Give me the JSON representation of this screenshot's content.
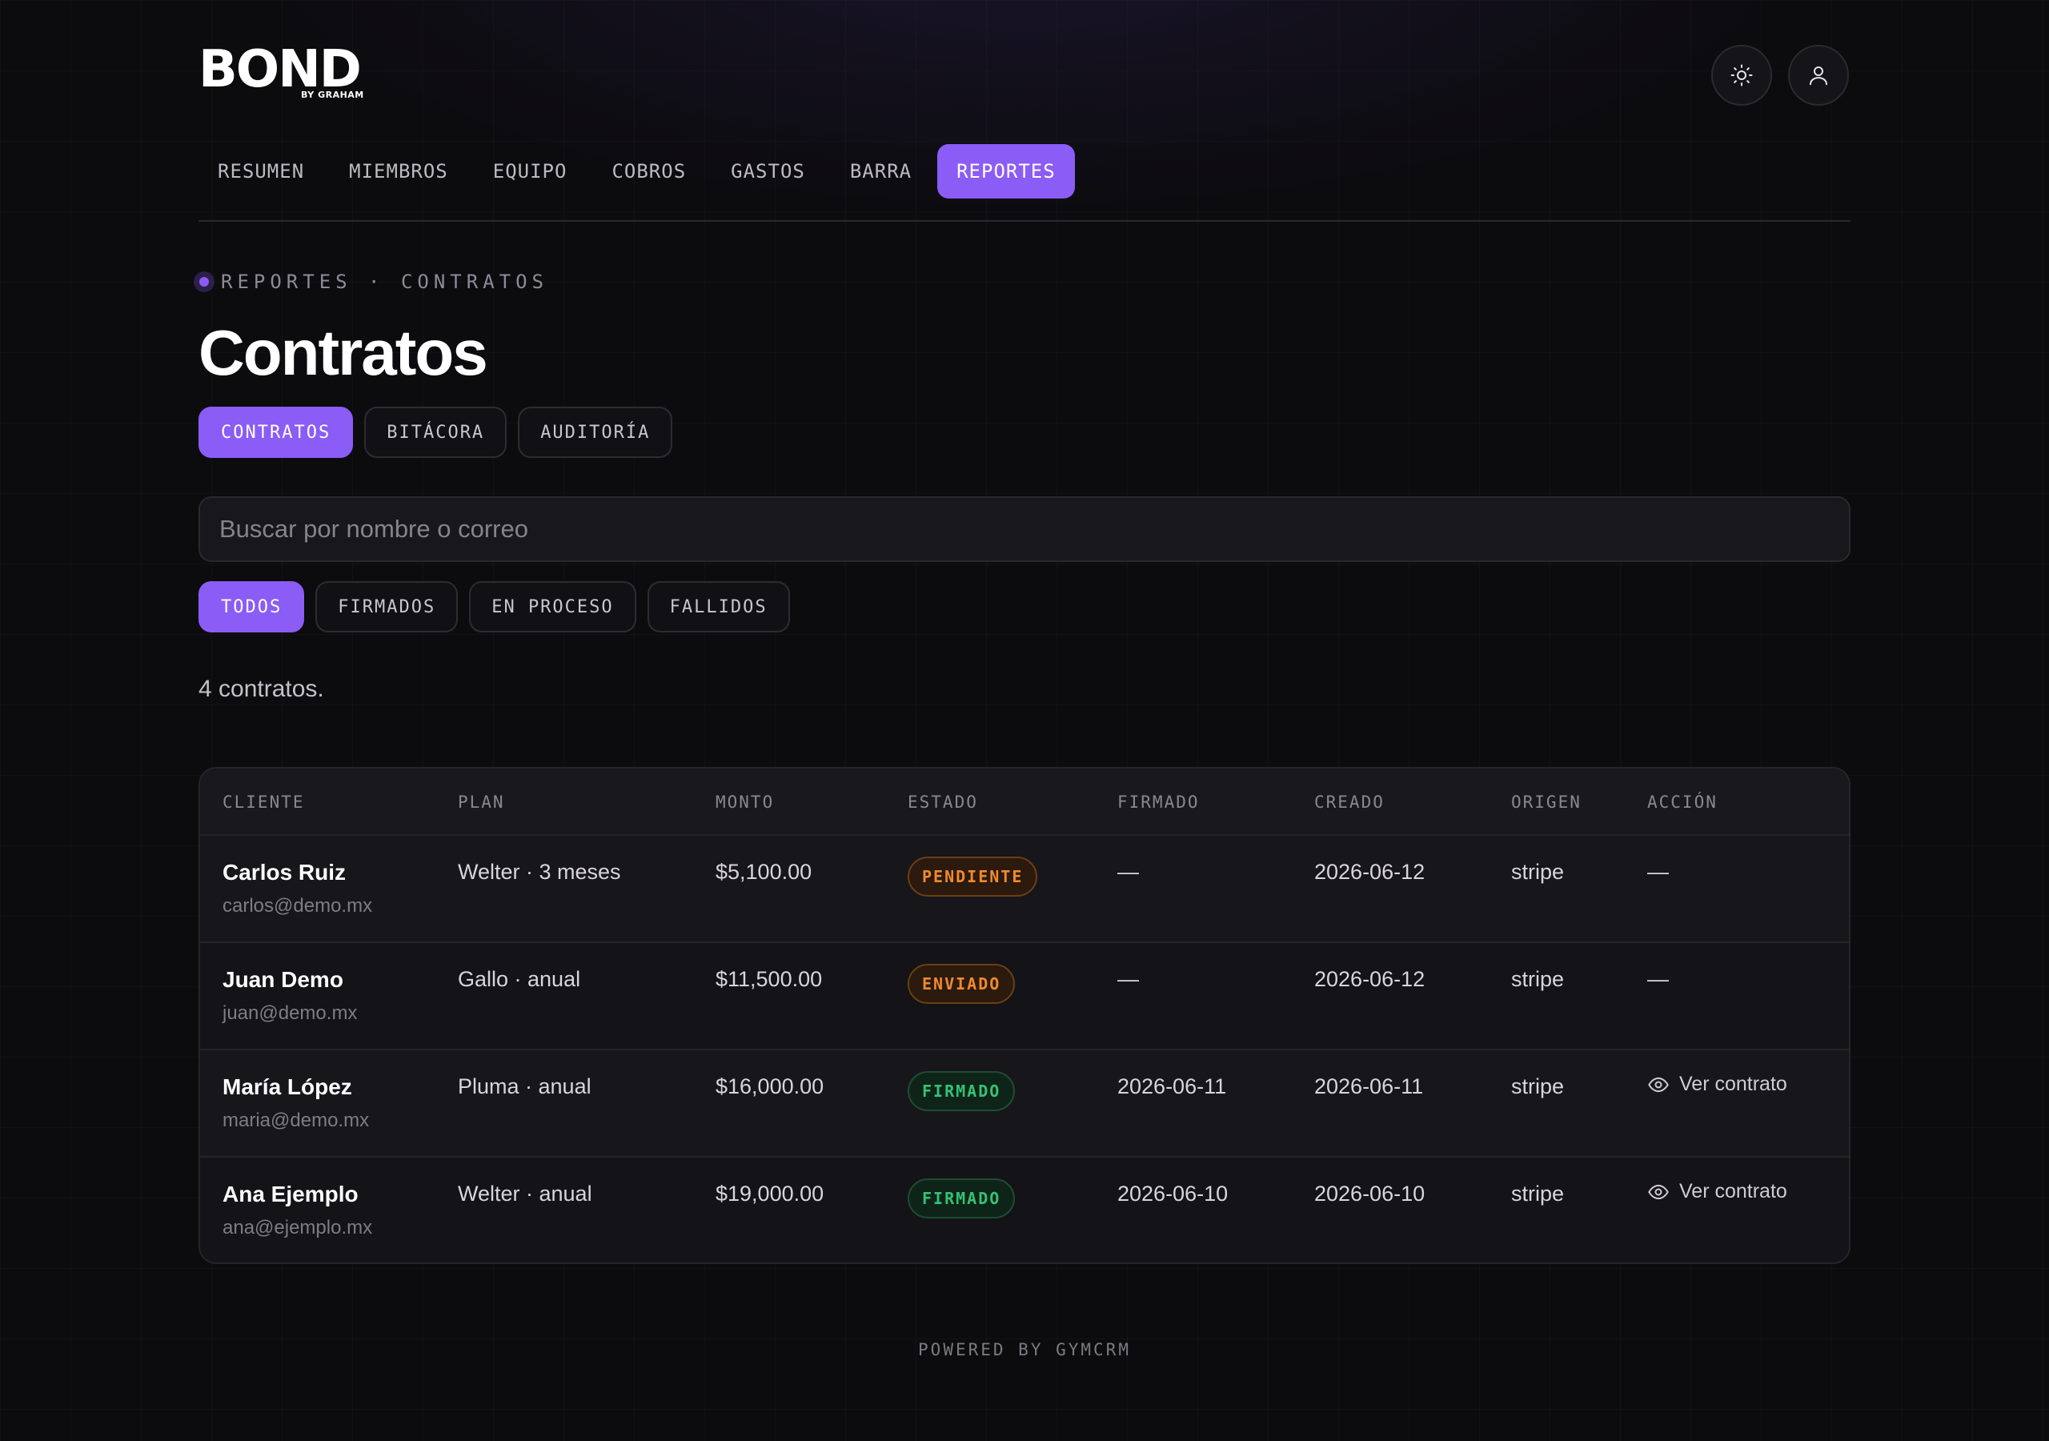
{
  "brand": {
    "name": "BOND",
    "sub": "BY GRAHAM"
  },
  "header": {
    "theme_icon": "sun-icon",
    "profile_icon": "user-icon"
  },
  "nav": {
    "items": [
      {
        "label": "RESUMEN"
      },
      {
        "label": "MIEMBROS"
      },
      {
        "label": "EQUIPO"
      },
      {
        "label": "COBROS"
      },
      {
        "label": "GASTOS"
      },
      {
        "label": "BARRA"
      },
      {
        "label": "REPORTES",
        "active": true
      }
    ]
  },
  "breadcrumb": "REPORTES · CONTRATOS",
  "page_title": "Contratos",
  "tabs": [
    {
      "label": "CONTRATOS",
      "active": true
    },
    {
      "label": "BITÁCORA"
    },
    {
      "label": "AUDITORÍA"
    }
  ],
  "search": {
    "placeholder": "Buscar por nombre o correo",
    "value": ""
  },
  "filters": [
    {
      "label": "TODOS",
      "active": true
    },
    {
      "label": "FIRMADOS"
    },
    {
      "label": "EN PROCESO"
    },
    {
      "label": "FALLIDOS"
    }
  ],
  "count_text": "4 contratos.",
  "table": {
    "headers": [
      "CLIENTE",
      "PLAN",
      "MONTO",
      "ESTADO",
      "FIRMADO",
      "CREADO",
      "ORIGEN",
      "ACCIÓN"
    ],
    "rows": [
      {
        "name": "Carlos Ruiz",
        "email": "carlos@demo.mx",
        "plan": "Welter · 3 meses",
        "amount": "$5,100.00",
        "status": "PENDIENTE",
        "signed": "—",
        "created": "2026-06-12",
        "origin": "stripe",
        "action": "—"
      },
      {
        "name": "Juan Demo",
        "email": "juan@demo.mx",
        "plan": "Gallo · anual",
        "amount": "$11,500.00",
        "status": "ENVIADO",
        "signed": "—",
        "created": "2026-06-12",
        "origin": "stripe",
        "action": "—"
      },
      {
        "name": "María López",
        "email": "maria@demo.mx",
        "plan": "Pluma · anual",
        "amount": "$16,000.00",
        "status": "FIRMADO",
        "signed": "2026-06-11",
        "created": "2026-06-11",
        "origin": "stripe",
        "action": "Ver contrato"
      },
      {
        "name": "Ana Ejemplo",
        "email": "ana@ejemplo.mx",
        "plan": "Welter · anual",
        "amount": "$19,000.00",
        "status": "FIRMADO",
        "signed": "2026-06-10",
        "created": "2026-06-10",
        "origin": "stripe",
        "action": "Ver contrato"
      }
    ]
  },
  "footer": "POWERED BY GYMCRM",
  "colors": {
    "accent": "#8b5cf6",
    "pending": "#f08a2c",
    "signed": "#34c273",
    "background": "#0c0b0e"
  }
}
